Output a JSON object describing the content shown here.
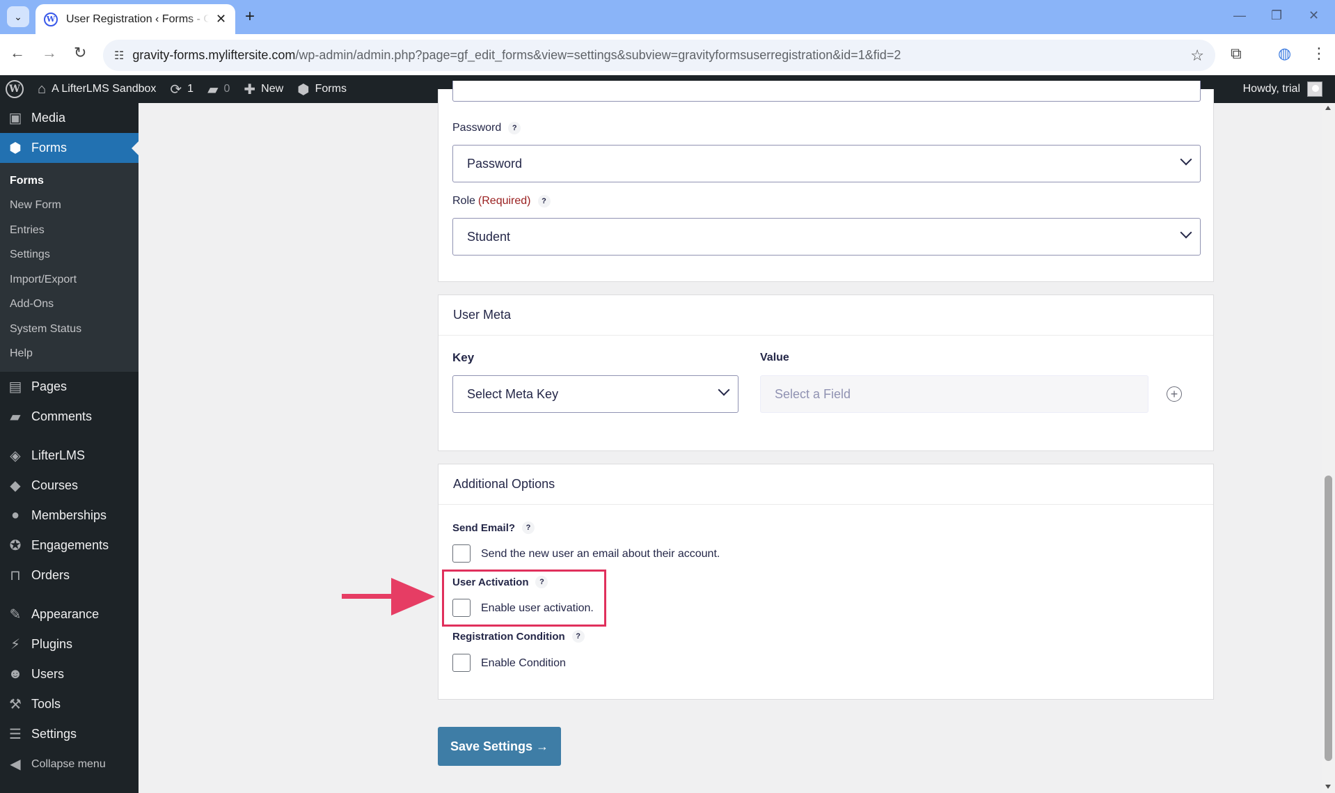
{
  "browser": {
    "tab_title": "User Registration ‹ Forms - Gravity Forms",
    "tab_favicon": "wordpress-icon",
    "url_host": "gravity-forms.mylifter­site.com",
    "url_host_text": "gravity-forms.myliftersite.com",
    "url_path": "/wp-admin/admin.php?page=gf_edit_forms&view=settings&subview=gravityformsuserregistration&id=1&fid=2",
    "tab_strip_color": "#8ab4f8"
  },
  "adminbar": {
    "site_name": "A LifterLMS Sandbox",
    "updates_count": "1",
    "comments_count": "0",
    "new_label": "New",
    "forms_label": "Forms",
    "howdy": "Howdy, trial"
  },
  "sidebar": {
    "top_items": [
      {
        "label": "Media",
        "icon": "media-icon"
      },
      {
        "label": "Forms",
        "icon": "forms-icon"
      }
    ],
    "submenu": [
      "Forms",
      "New Form",
      "Entries",
      "Settings",
      "Import/Export",
      "Add-Ons",
      "System Status",
      "Help"
    ],
    "items_a": [
      {
        "label": "Pages",
        "icon": "pages-icon"
      },
      {
        "label": "Comments",
        "icon": "comments-icon"
      }
    ],
    "items_b": [
      {
        "label": "LifterLMS",
        "icon": "lifterlms-icon"
      },
      {
        "label": "Courses",
        "icon": "courses-icon"
      },
      {
        "label": "Memberships",
        "icon": "memberships-icon"
      },
      {
        "label": "Engagements",
        "icon": "engagements-icon"
      },
      {
        "label": "Orders",
        "icon": "orders-icon"
      }
    ],
    "items_c": [
      {
        "label": "Appearance",
        "icon": "appearance-icon"
      },
      {
        "label": "Plugins",
        "icon": "plugins-icon"
      },
      {
        "label": "Users",
        "icon": "users-icon"
      },
      {
        "label": "Tools",
        "icon": "tools-icon"
      },
      {
        "label": "Settings",
        "icon": "settings-icon"
      },
      {
        "label": "Collapse menu",
        "icon": "collapse-icon"
      }
    ],
    "active_color": "#2271b1"
  },
  "fields": {
    "password_label": "Password",
    "password_value": "Password",
    "role_label": "Role",
    "role_required": "(Required)",
    "role_value": "Student",
    "help_mark": "?"
  },
  "user_meta": {
    "title": "User Meta",
    "key_label": "Key",
    "value_label": "Value",
    "key_value": "Select Meta Key",
    "value_placeholder": "Select a Field"
  },
  "additional_options": {
    "title": "Additional Options",
    "send_email_label": "Send Email?",
    "send_email_checkbox": "Send the new user an email about their account.",
    "user_activation_label": "User Activation",
    "user_activation_checkbox": "Enable user activation.",
    "registration_condition_label": "Registration Condition",
    "registration_condition_checkbox": "Enable Condition"
  },
  "save_button": "Save Settings  →",
  "highlight_color": "#e0305c"
}
